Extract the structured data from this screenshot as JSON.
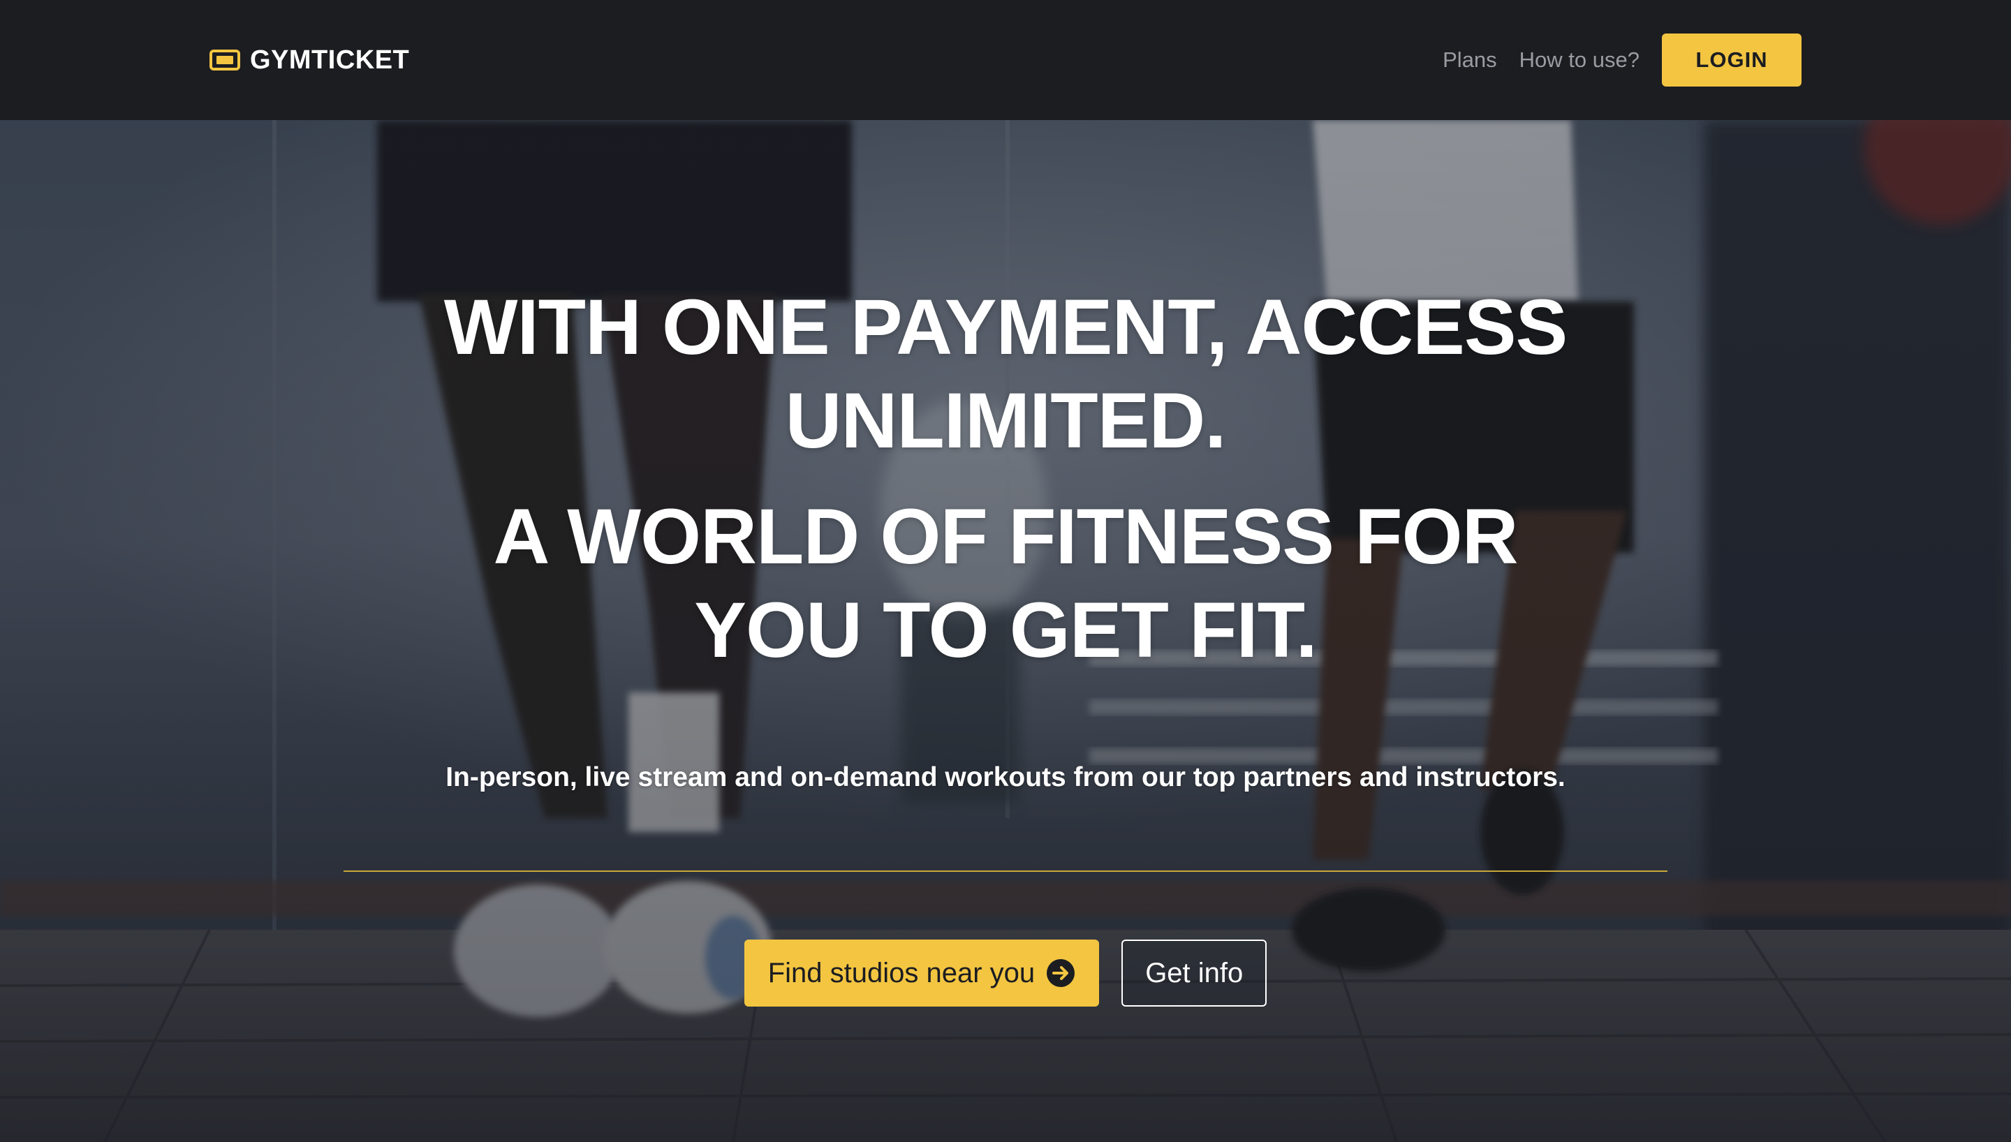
{
  "brand": {
    "name": "GYMTICKET",
    "icon": "ticket-icon",
    "accent_color": "#f3c541"
  },
  "nav": {
    "links": [
      "Plans",
      "How to use?"
    ],
    "login_label": "LOGIN"
  },
  "hero": {
    "headline_line1": "WITH ONE PAYMENT, ACCESS",
    "headline_line2": "UNLIMITED.",
    "headline_line3": "A WORLD OF FITNESS FOR",
    "headline_line4": "YOU TO GET FIT.",
    "subtext": "In-person, live stream and on-demand workouts from our top partners and instructors.",
    "primary_cta": "Find studios near you",
    "primary_cta_icon": "arrow-right-circle-icon",
    "secondary_cta": "Get info"
  },
  "colors": {
    "navbar_bg": "#1c1d21",
    "accent": "#f3c541",
    "divider": "#c9a73a"
  }
}
